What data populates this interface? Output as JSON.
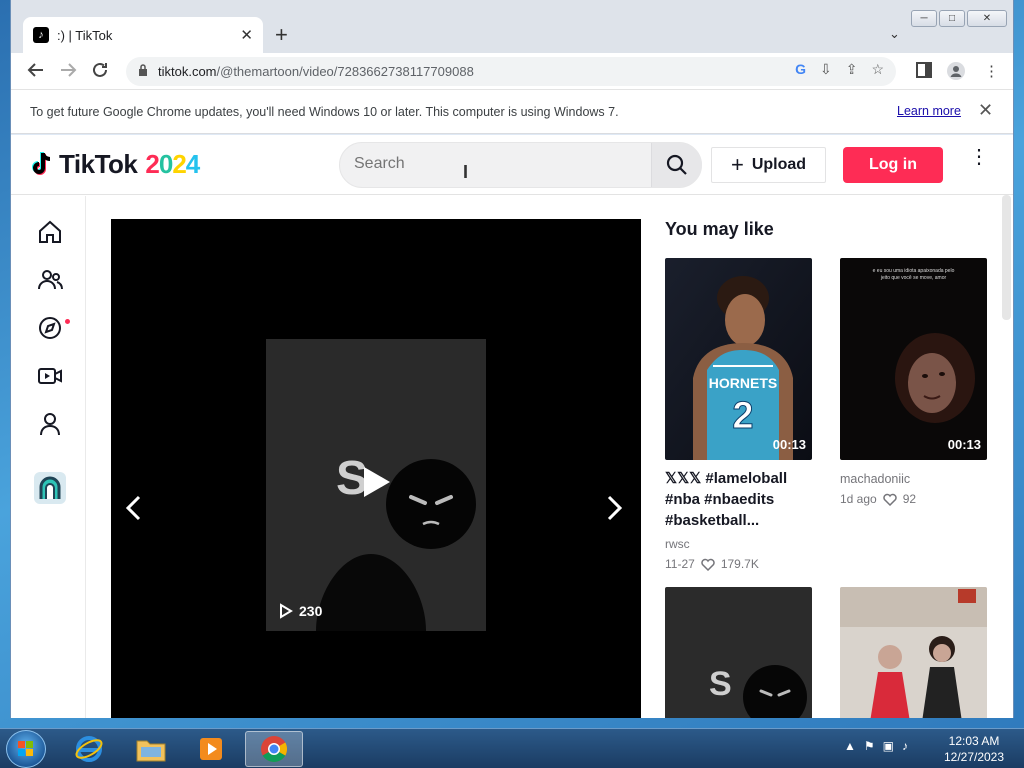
{
  "browser": {
    "tab_title": ":) | TikTok",
    "tab_close": "✕",
    "new_tab": "+",
    "tab_menu": "⌄",
    "win_min": "─",
    "win_max": "□",
    "win_close": "✕",
    "url_host": "tiktok.com",
    "url_path": "/@themartoon/video/7283662738117709088",
    "infobar_text": "To get future Google Chrome updates, you'll need Windows 10 or later. This computer is using Windows 7.",
    "infobar_link": "Learn more",
    "infobar_close": "✕"
  },
  "tiktok": {
    "logo_text": "TikTok",
    "logo_year": "2024",
    "search_placeholder": "Search",
    "upload_label": "Upload",
    "upload_plus": "+",
    "login_label": "Log in",
    "more": "⋮",
    "video_views": "230",
    "video_overlay_letter": "S"
  },
  "recommendations": {
    "title": "You may like",
    "items": [
      {
        "duration": "00:13",
        "caption": "𝕏𝕏𝕏 #lameloball #nba #nbaedits #basketball...",
        "author": "rwsc",
        "date": "11-27",
        "likes": "179.7K",
        "jersey_text": "HORNETS",
        "jersey_number": "2"
      },
      {
        "duration": "00:13",
        "caption": "",
        "author": "machadoniic",
        "date": "1d ago",
        "likes": "92",
        "overlay_text": "e eu sou uma idiota apaixonada pelo jeito que você se move, amor"
      },
      {
        "duration": "",
        "caption": "",
        "author": "",
        "date": "",
        "likes": "",
        "overlay_letter": "S"
      },
      {
        "duration": "",
        "caption": "",
        "author": "",
        "date": "",
        "likes": ""
      }
    ]
  },
  "taskbar": {
    "time": "12:03 AM",
    "date": "12/27/2023"
  },
  "colors": {
    "tiktok_red": "#fe2c55",
    "link_blue": "#1a0dab"
  }
}
